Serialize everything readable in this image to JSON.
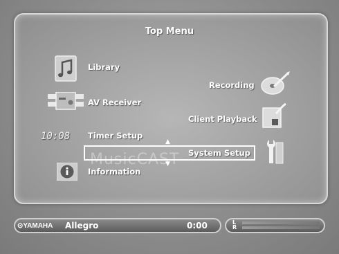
{
  "menu": {
    "title": "Top Menu",
    "watermark": "MusicCAST",
    "items": {
      "library": "Library",
      "av_receiver": "AV Receiver",
      "timer_setup": "Timer Setup",
      "information": "Information",
      "recording": "Recording",
      "client_playback": "Client Playback",
      "system_setup": "System Setup"
    },
    "timer_display": "10:08",
    "selected_item": "System Setup"
  },
  "status": {
    "brand": "YAMAHA",
    "track": "Allegro",
    "time": "0:00",
    "meter_left": "L",
    "meter_right": "R"
  },
  "icons": {
    "library": "music-note-icon",
    "av_receiver": "receiver-icon",
    "information": "info-icon",
    "recording": "disc-recording-icon",
    "client_playback": "playback-icon",
    "system_setup": "wrench-icon",
    "brand": "yamaha-logo-icon"
  }
}
